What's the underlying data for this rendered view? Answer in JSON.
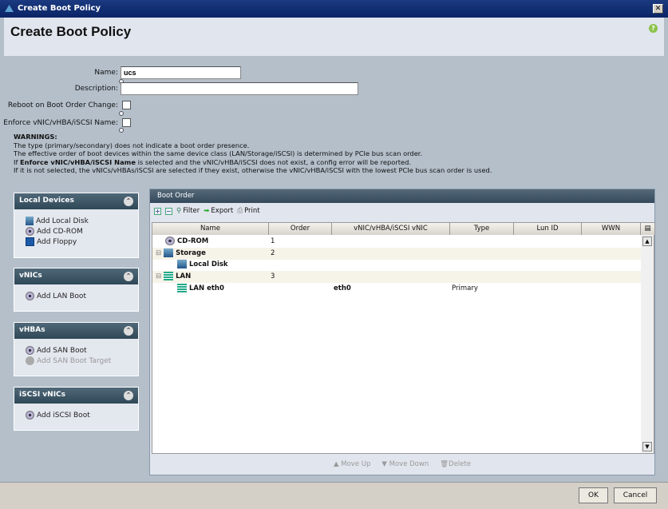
{
  "window": {
    "title": "Create Boot Policy",
    "close": "✕"
  },
  "header": {
    "title": "Create Boot Policy",
    "help": "?"
  },
  "form": {
    "name_label": "Name:",
    "name_value": "ucs",
    "description_label": "Description:",
    "description_value": "",
    "reboot_label": "Reboot on Boot Order Change:",
    "reboot_checked": false,
    "enforce_label": "Enforce vNIC/vHBA/iSCSI Name:",
    "enforce_checked": false
  },
  "warnings": {
    "title": "WARNINGS:",
    "line1": "The type (primary/secondary) does not indicate a boot order presence.",
    "line2": "The effective order of boot devices within the same device class (LAN/Storage/iSCSI) is determined by PCIe bus scan order.",
    "line3_pre": "If ",
    "line3_bold": "Enforce vNIC/vHBA/iSCSI Name",
    "line3_post": " is selected and the vNIC/vHBA/iSCSI does not exist, a config error will be reported.",
    "line4": "If it is not selected, the vNICs/vHBAs/iSCSI are selected if they exist, otherwise the vNIC/vHBA/iSCSI with the lowest PCIe bus scan order is used."
  },
  "panels": [
    {
      "title": "Local Devices",
      "items": [
        "Add Local Disk",
        "Add CD-ROM",
        "Add Floppy"
      ]
    },
    {
      "title": "vNICs",
      "items": [
        "Add LAN Boot"
      ]
    },
    {
      "title": "vHBAs",
      "items": [
        "Add SAN Boot",
        "Add SAN Boot Target"
      ]
    },
    {
      "title": "iSCSI vNICs",
      "items": [
        "Add iSCSI Boot"
      ]
    }
  ],
  "boot_order": {
    "title": "Boot Order",
    "toolbar": {
      "filter": "Filter",
      "export": "Export",
      "print": "Print"
    },
    "columns": [
      "Name",
      "Order",
      "vNIC/vHBA/iSCSI vNIC",
      "Type",
      "Lun ID",
      "WWN"
    ],
    "rows": [
      {
        "name": "CD-ROM",
        "order": "1",
        "vnic": "",
        "type": "",
        "lun": "",
        "wwn": ""
      },
      {
        "name": "Storage",
        "order": "2",
        "vnic": "",
        "type": "",
        "lun": "",
        "wwn": ""
      },
      {
        "name": "Local Disk",
        "order": "",
        "vnic": "",
        "type": "",
        "lun": "",
        "wwn": ""
      },
      {
        "name": "LAN",
        "order": "3",
        "vnic": "",
        "type": "",
        "lun": "",
        "wwn": ""
      },
      {
        "name": "LAN eth0",
        "order": "",
        "vnic": "eth0",
        "type": "Primary",
        "lun": "",
        "wwn": ""
      }
    ],
    "actions": {
      "move_up": "Move Up",
      "move_down": "Move Down",
      "delete": "Delete"
    }
  },
  "footer": {
    "ok": "OK",
    "cancel": "Cancel"
  }
}
